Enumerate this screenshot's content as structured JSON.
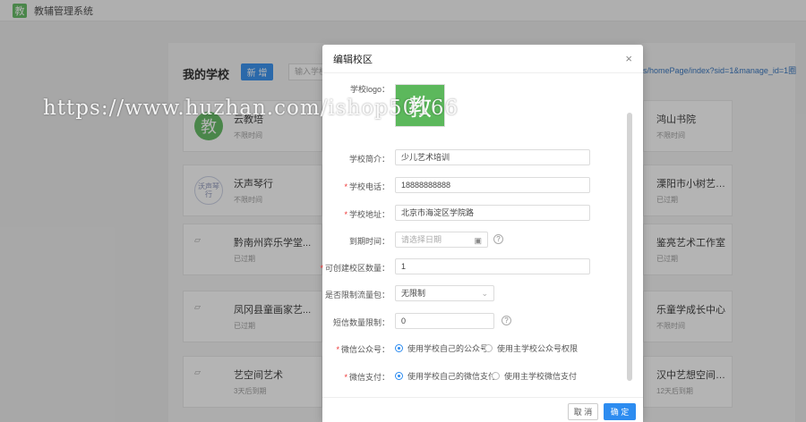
{
  "app": {
    "logo_char": "教",
    "title": "教辅管理系统"
  },
  "page": {
    "heading": "我的学校",
    "add_button": "新 增",
    "search_placeholder": "输入学校名",
    "url_text": "s/homePage/index?sid=1&manage_id=1圈"
  },
  "cards_left": [
    {
      "logo": "教",
      "name": "云教培",
      "sub": "不限时间"
    },
    {
      "logo": "沃声琴行",
      "name": "沃声琴行",
      "sub": "不限时间"
    },
    {
      "logo": "▱",
      "name": "黔南州弈乐学堂...",
      "sub": "已过期"
    },
    {
      "logo": "▱",
      "name": "凤冈县童画家艺...",
      "sub": "已过期"
    },
    {
      "logo": "▱",
      "name": "艺空间艺术",
      "sub": "3天后到期"
    }
  ],
  "cards_right": [
    {
      "name": "鸿山书院",
      "sub": "不限时间"
    },
    {
      "name": "溧阳市小树艺术...",
      "sub": "已过期"
    },
    {
      "name": "鉴亮艺术工作室",
      "sub": "已过期"
    },
    {
      "name": "乐童学成长中心",
      "sub": "不限时间"
    },
    {
      "name": "汉中艺想空间书...",
      "sub": "12天后到期"
    }
  ],
  "modal": {
    "title": "编辑校区",
    "close": "×",
    "logo_label": "学校logo：",
    "logo_char": "教",
    "intro_label": "学校简介：",
    "intro_value": "少儿艺术培训",
    "phone_label": "学校电话：",
    "phone_value": "18888888888",
    "address_label": "学校地址：",
    "address_value": "北京市海淀区学院路",
    "expire_label": "到期时间：",
    "expire_placeholder": "请选择日期",
    "campus_count_label": "可创建校区数量：",
    "campus_count_value": "1",
    "limit_traffic_label": "是否限制流量包：",
    "limit_traffic_value": "无限制",
    "sms_label": "短信数量限制：",
    "sms_value": "0",
    "wechat_label": "微信公众号：",
    "wechat_option1": "使用学校自己的公众号",
    "wechat_option2": "使用主学校公众号权限",
    "pay_label": "微信支付：",
    "pay_option1": "使用学校自己的微信支付",
    "pay_option2": "使用主学校微信支付",
    "required_mark": "*",
    "cancel": "取 消",
    "ok": "确 定"
  },
  "watermark": "https://www.huzhan.com/ishop50166",
  "colors": {
    "primary": "#2d8cf0",
    "logo_green": "#5cb85c",
    "required": "#e33333"
  }
}
